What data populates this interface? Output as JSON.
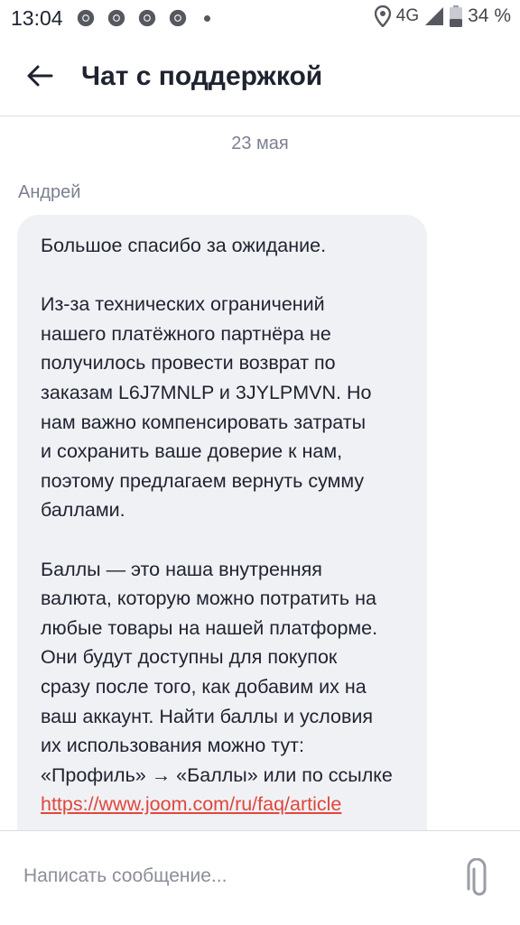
{
  "statusbar": {
    "time": "13:04",
    "network": "4G",
    "battery": "34 %",
    "icons": [
      "chrome-icon",
      "chrome-icon",
      "chrome-icon",
      "chrome-icon",
      "notification-dot",
      "location-icon",
      "signal-icon",
      "battery-icon"
    ]
  },
  "header": {
    "title": "Чат с поддержкой",
    "back_icon": "arrow-left-icon"
  },
  "chat": {
    "date": "23 мая",
    "sender": "Андрей",
    "message": {
      "line1": "Большое спасибо за ожидание.",
      "para2": [
        "Из-за технических ограничений",
        "нашего платёжного партнёра не",
        "получилось провести возврат по",
        "заказам L6J7MNLP и 3JYLPMVN. Но",
        "нам важно компенсировать затраты",
        "и сохранить ваше доверие к нам,",
        "поэтому предлагаем вернуть сумму",
        "баллами."
      ],
      "para3": [
        "Баллы — это наша внутренняя",
        "валюта, которую можно потратить на",
        "любые товары на нашей платформе.",
        "Они будут доступны для покупок",
        "сразу после того, как добавим их на",
        "ваш аккаунт. Найти баллы и условия",
        "их использования можно тут:",
        "«Профиль» → «Баллы» или по ссылке"
      ],
      "link": "https://www.joom.com/ru/faq/article"
    }
  },
  "composer": {
    "placeholder": "Написать сообщение...",
    "attach_icon": "paperclip-icon"
  },
  "colors": {
    "link": "#e0473c",
    "bubble": "#f0f1f5",
    "muted": "#7c8090"
  }
}
